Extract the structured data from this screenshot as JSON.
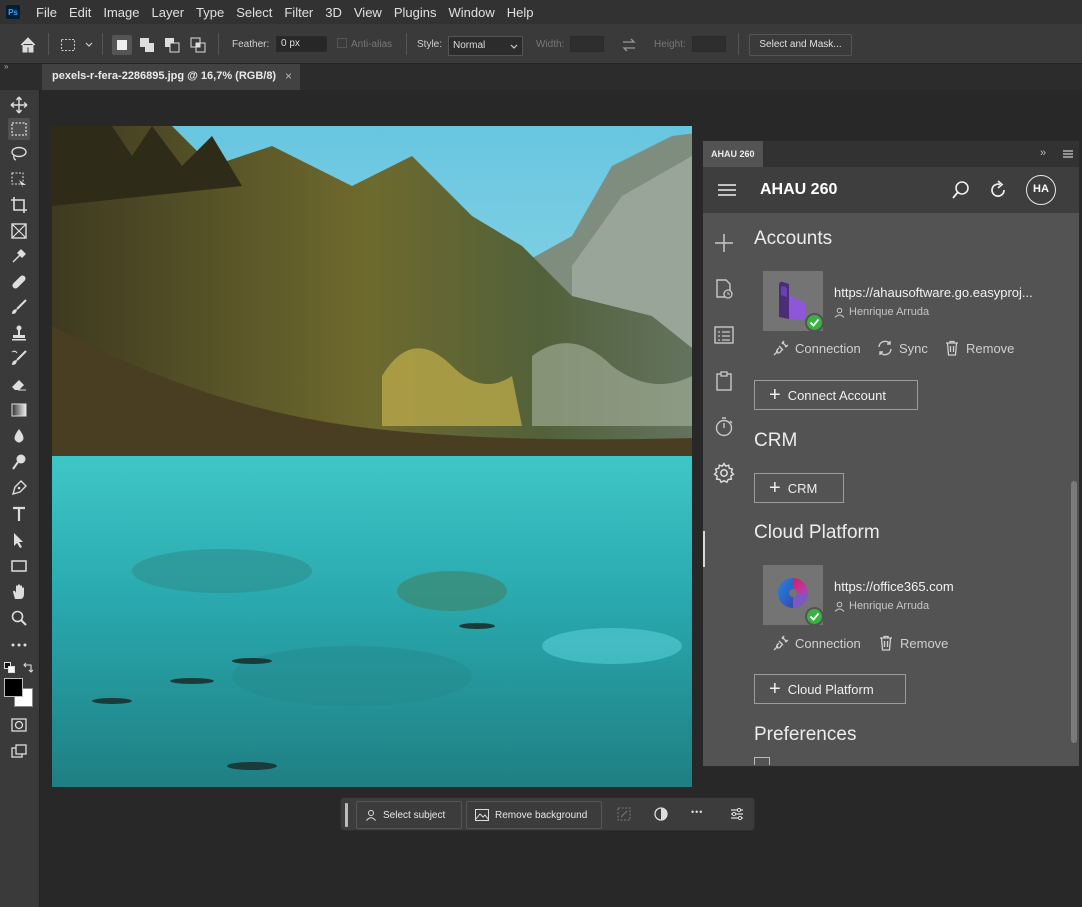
{
  "app": {
    "logo": "Ps",
    "menu": [
      "File",
      "Edit",
      "Image",
      "Layer",
      "Type",
      "Select",
      "Filter",
      "3D",
      "View",
      "Plugins",
      "Window",
      "Help"
    ]
  },
  "options_bar": {
    "feather_label": "Feather:",
    "feather_value": "0 px",
    "anti_alias_label": "Anti-alias",
    "style_label": "Style:",
    "style_value": "Normal",
    "width_label": "Width:",
    "height_label": "Height:",
    "select_mask_label": "Select and Mask..."
  },
  "document": {
    "tab_title": "pexels-r-fera-2286895.jpg @ 16,7% (RGB/8)",
    "close_glyph": "×"
  },
  "context_bar": {
    "select_subject": "Select subject",
    "remove_background": "Remove background",
    "more_glyph": "•••"
  },
  "panel": {
    "tab_label": "AHAU 260",
    "title": "AHAU 260",
    "avatar": "HA",
    "sections": {
      "accounts_title": "Accounts",
      "crm_title": "CRM",
      "cloud_title": "Cloud Platform",
      "preferences_title": "Preferences"
    },
    "accounts": [
      {
        "url": "https://ahausoftware.go.easyproj...",
        "user": "Henrique Arruda",
        "actions": [
          "Connection",
          "Sync",
          "Remove"
        ]
      }
    ],
    "cloud": [
      {
        "url": "https://office365.com",
        "user": "Henrique Arruda",
        "actions": [
          "Connection",
          "Remove"
        ]
      }
    ],
    "buttons": {
      "connect_account": "Connect Account",
      "crm": "CRM",
      "cloud_platform": "Cloud Platform"
    }
  },
  "colors": {
    "accent_check": "#3cb043",
    "panel_bg": "#535353",
    "app_bg": "#282828"
  }
}
